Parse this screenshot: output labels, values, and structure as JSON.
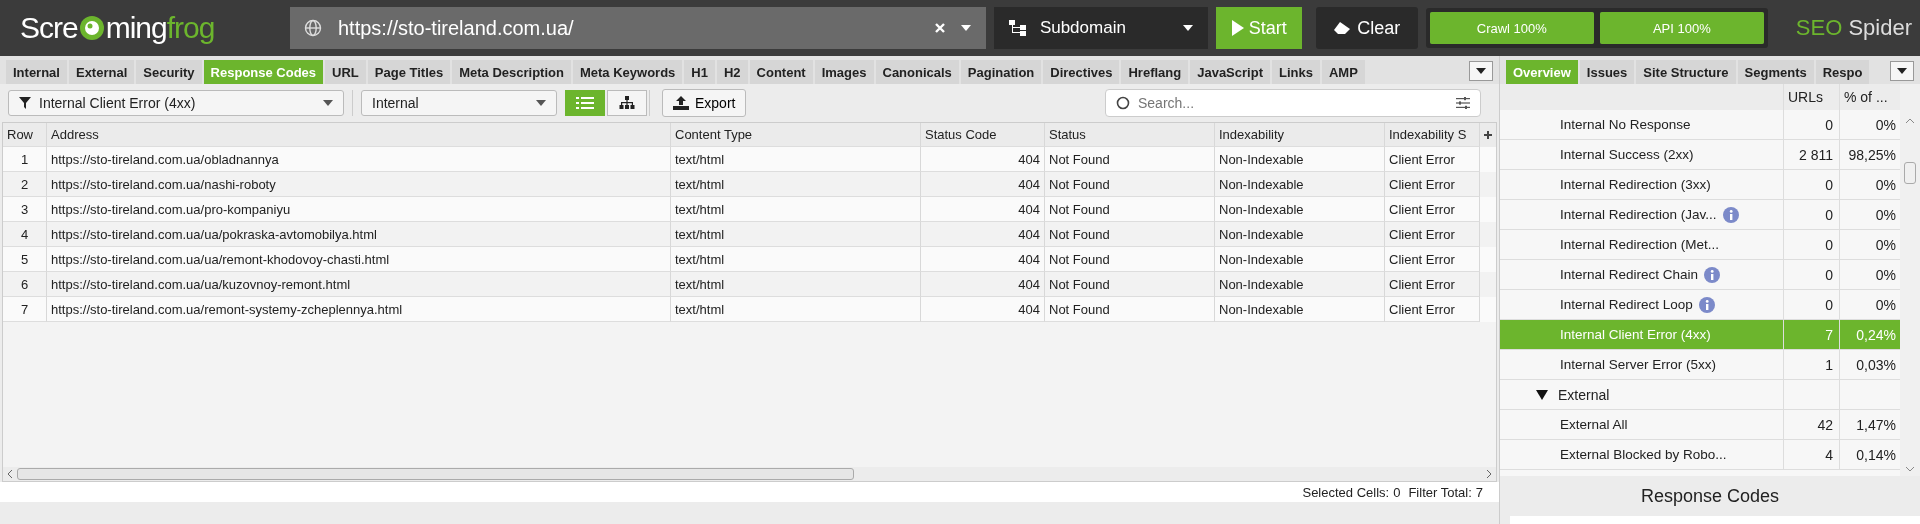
{
  "logo": [
    "Scre",
    "ming",
    "frog"
  ],
  "url_field": {
    "value": "https://sto-tireland.com.ua/"
  },
  "mode_dropdown": {
    "value": "Subdomain"
  },
  "start_button": "Start",
  "clear_button": "Clear",
  "progress": [
    {
      "label": "Crawl 100%",
      "level": 1
    },
    {
      "label": "API 100%",
      "level": 1
    }
  ],
  "product_name": [
    "SEO",
    "Spider"
  ],
  "tabs": [
    {
      "label": "Internal",
      "selected": false
    },
    {
      "label": "External",
      "selected": false
    },
    {
      "label": "Security",
      "selected": false
    },
    {
      "label": "Response Codes",
      "selected": true
    },
    {
      "label": "URL",
      "selected": false
    },
    {
      "label": "Page Titles",
      "selected": false
    },
    {
      "label": "Meta Description",
      "selected": false
    },
    {
      "label": "Meta Keywords",
      "selected": false
    },
    {
      "label": "H1",
      "selected": false
    },
    {
      "label": "H2",
      "selected": false
    },
    {
      "label": "Content",
      "selected": false
    },
    {
      "label": "Images",
      "selected": false
    },
    {
      "label": "Canonicals",
      "selected": false
    },
    {
      "label": "Pagination",
      "selected": false
    },
    {
      "label": "Directives",
      "selected": false
    },
    {
      "label": "Hreflang",
      "selected": false
    },
    {
      "label": "JavaScript",
      "selected": false
    },
    {
      "label": "Links",
      "selected": false
    },
    {
      "label": "AMP",
      "selected": false
    }
  ],
  "filter_dropdown": {
    "value": "Internal Client Error (4xx)"
  },
  "scope_dropdown": {
    "value": "Internal"
  },
  "views": [
    {
      "kind": "list",
      "selected": true
    },
    {
      "kind": "tree",
      "selected": false
    }
  ],
  "export_button": "Export",
  "search": {
    "placeholder": "Search..."
  },
  "table": {
    "columns": [
      "Row",
      "Address",
      "Content Type",
      "Status Code",
      "Status",
      "Indexability",
      "Indexability S"
    ],
    "rows": [
      [
        "1",
        "https://sto-tireland.com.ua/obladnannya",
        "text/html",
        "404",
        "Not Found",
        "Non-Indexable",
        "Client Error"
      ],
      [
        "2",
        "https://sto-tireland.com.ua/nashi-roboty",
        "text/html",
        "404",
        "Not Found",
        "Non-Indexable",
        "Client Error"
      ],
      [
        "3",
        "https://sto-tireland.com.ua/pro-kompaniyu",
        "text/html",
        "404",
        "Not Found",
        "Non-Indexable",
        "Client Error"
      ],
      [
        "4",
        "https://sto-tireland.com.ua/ua/pokraska-avtomobilya.html",
        "text/html",
        "404",
        "Not Found",
        "Non-Indexable",
        "Client Error"
      ],
      [
        "5",
        "https://sto-tireland.com.ua/ua/remont-khodovoy-chasti.html",
        "text/html",
        "404",
        "Not Found",
        "Non-Indexable",
        "Client Error"
      ],
      [
        "6",
        "https://sto-tireland.com.ua/ua/kuzovnoy-remont.html",
        "text/html",
        "404",
        "Not Found",
        "Non-Indexable",
        "Client Error"
      ],
      [
        "7",
        "https://sto-tireland.com.ua/remont-systemy-zcheplennya.html",
        "text/html",
        "404",
        "Not Found",
        "Non-Indexable",
        "Client Error"
      ]
    ]
  },
  "status_bar": [
    {
      "label": "Selected Cells:",
      "value": "0"
    },
    {
      "label": "Filter Total:",
      "value": "7"
    }
  ],
  "right_tabs": [
    {
      "label": "Overview",
      "selected": true
    },
    {
      "label": "Issues",
      "selected": false
    },
    {
      "label": "Site Structure",
      "selected": false
    },
    {
      "label": "Segments",
      "selected": false
    },
    {
      "label": "Respo",
      "selected": false
    }
  ],
  "overview": {
    "columns": [
      "URLs",
      "% of ..."
    ],
    "items": [
      {
        "label": "Internal No Response",
        "urls": "0",
        "percent": "0%",
        "info": false,
        "selected": false
      },
      {
        "label": "Internal Success (2xx)",
        "urls": "2 811",
        "percent": "98,25%",
        "info": false,
        "selected": false
      },
      {
        "label": "Internal Redirection (3xx)",
        "urls": "0",
        "percent": "0%",
        "info": false,
        "selected": false
      },
      {
        "label": "Internal Redirection (Jav...",
        "urls": "0",
        "percent": "0%",
        "info": true,
        "selected": false
      },
      {
        "label": "Internal Redirection (Met...",
        "urls": "0",
        "percent": "0%",
        "info": false,
        "selected": false
      },
      {
        "label": "Internal Redirect Chain",
        "urls": "0",
        "percent": "0%",
        "info": true,
        "selected": false
      },
      {
        "label": "Internal Redirect Loop",
        "urls": "0",
        "percent": "0%",
        "info": true,
        "selected": false
      },
      {
        "label": "Internal Client Error (4xx)",
        "urls": "7",
        "percent": "0,24%",
        "info": false,
        "selected": true
      },
      {
        "label": "Internal Server Error (5xx)",
        "urls": "1",
        "percent": "0,03%",
        "info": false,
        "selected": false
      },
      {
        "label": "External",
        "expanded": true,
        "selected": false,
        "children": [
          {
            "label": "External All",
            "urls": "42",
            "percent": "1,47%",
            "info": false,
            "selected": false
          },
          {
            "label": "External Blocked by Robo...",
            "urls": "4",
            "percent": "0,14%",
            "info": false,
            "selected": false
          }
        ]
      }
    ]
  },
  "panel_title": "Response Codes"
}
